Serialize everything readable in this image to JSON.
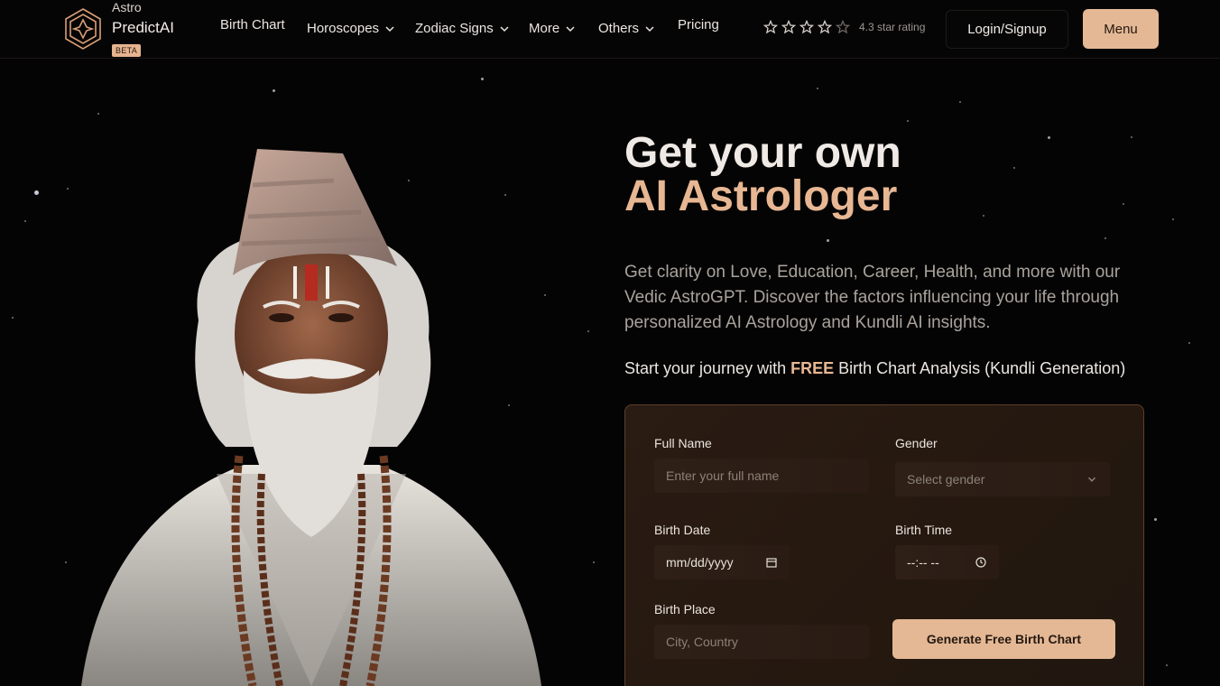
{
  "brand": {
    "top": "Astro",
    "main": "PredictAI",
    "badge": "BETA"
  },
  "nav": [
    {
      "label": "Birth Chart",
      "dropdown": false
    },
    {
      "label": "Horoscopes",
      "dropdown": true
    },
    {
      "label": "Zodiac Signs",
      "dropdown": true
    },
    {
      "label": "More",
      "dropdown": true
    },
    {
      "label": "Others",
      "dropdown": true
    },
    {
      "label": "Pricing",
      "dropdown": false
    }
  ],
  "rating": {
    "stars": 5,
    "value": 4.3,
    "text": "4.3 star rating"
  },
  "header_buttons": {
    "login": "Login/Signup",
    "menu": "Menu"
  },
  "hero": {
    "headline_1": "Get your own",
    "headline_2": "AI Astrologer",
    "description": "Get clarity on Love, Education, Career, Health, and more with our Vedic AstroGPT. Discover the factors influencing your life through personalized AI Astrology and Kundli AI insights.",
    "journey_prefix": "Start your journey with ",
    "journey_highlight": "FREE",
    "journey_suffix": " Birth Chart Analysis (Kundli Generation)"
  },
  "form": {
    "full_name": {
      "label": "Full Name",
      "placeholder": "Enter your full name"
    },
    "gender": {
      "label": "Gender",
      "placeholder": "Select gender"
    },
    "birth_date": {
      "label": "Birth Date",
      "value": "mm/dd/yyyy"
    },
    "birth_time": {
      "label": "Birth Time",
      "value": "--:-- --"
    },
    "birth_place": {
      "label": "Birth Place",
      "placeholder": "City, Country"
    },
    "submit": "Generate Free Birth Chart"
  },
  "colors": {
    "accent": "#e4b895",
    "headline_accent": "#e7b793",
    "background": "#050404",
    "card_border": "#5b3f2a"
  },
  "icons": [
    "astro-logo-icon",
    "chevron-down-icon",
    "star-outline-icon",
    "calendar-icon",
    "clock-icon"
  ]
}
